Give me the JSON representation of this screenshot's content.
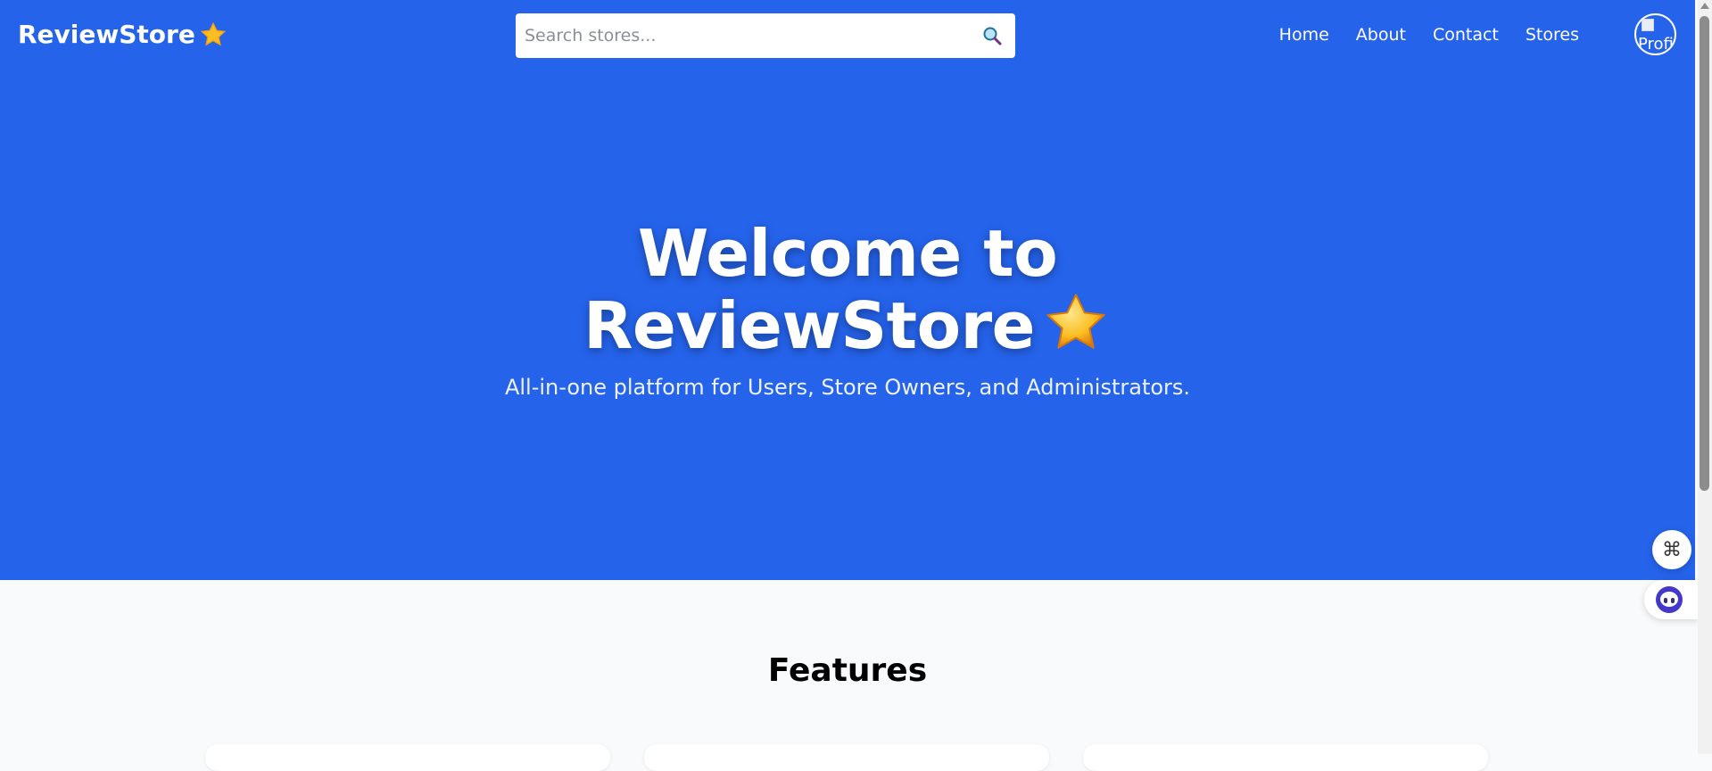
{
  "navbar": {
    "brand": "ReviewStore",
    "brand_icon": "star-icon",
    "search": {
      "placeholder": "Search stores...",
      "value": "",
      "button_icon": "search-icon"
    },
    "links": [
      {
        "label": "Home"
      },
      {
        "label": "About"
      },
      {
        "label": "Contact"
      },
      {
        "label": "Stores"
      }
    ],
    "avatar_alt": "Profile"
  },
  "hero": {
    "title_line1": "Welcome to",
    "title_line2": "ReviewStore",
    "subtitle": "All-in-one platform for Users, Store Owners, and Administrators.",
    "background_color": "#2563eb"
  },
  "features": {
    "title": "Features",
    "cards": [
      {},
      {},
      {}
    ]
  },
  "floating_widgets": [
    {
      "icon": "command-icon"
    },
    {
      "icon": "assistant-bot-icon"
    }
  ]
}
